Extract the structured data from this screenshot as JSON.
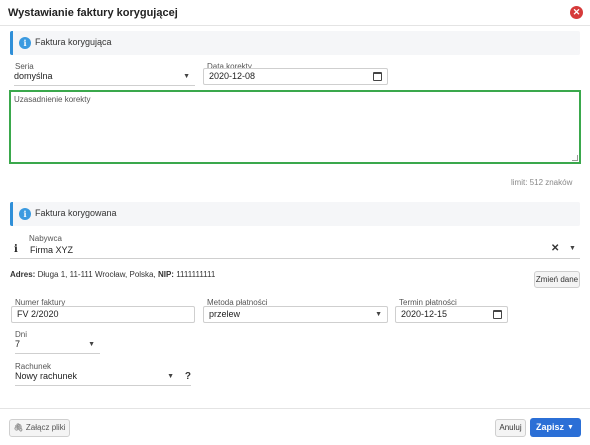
{
  "dialog": {
    "title": "Wystawianie faktury korygującej"
  },
  "section_correction": {
    "title": "Faktura korygująca"
  },
  "seria": {
    "label": "Seria",
    "value": "domyślna"
  },
  "data_korekty": {
    "label": "Data korekty",
    "value": "2020-12-08"
  },
  "uzasadnienie": {
    "placeholder": "Uzasadnienie korekty",
    "limit_text": "limit: 512 znaków"
  },
  "section_corrected": {
    "title": "Faktura korygowana"
  },
  "nabywca": {
    "label": "Nabywca",
    "value": "Firma XYZ"
  },
  "adres": {
    "label": "Adres:",
    "value": "Długa 1, 11-111 Wrocław, Polska,",
    "nip_label": "NIP:",
    "nip_value": "1111111111"
  },
  "zmien_dane_label": "Zmień dane",
  "numer_faktury": {
    "label": "Numer faktury",
    "value": "FV 2/2020"
  },
  "metoda_platnosci": {
    "label": "Metoda płatności",
    "value": "przelew"
  },
  "termin_platnosci": {
    "label": "Termin płatności",
    "value": "2020-12-15"
  },
  "dni": {
    "label": "Dni",
    "value": "7"
  },
  "rachunek": {
    "label": "Rachunek",
    "value": "Nowy rachunek",
    "help": "?"
  },
  "footer": {
    "attach_label": "Załącz pliki",
    "cancel_label": "Anuluj",
    "save_label": "Zapisz"
  },
  "icons": {
    "close": "close-icon",
    "info": "info-icon",
    "calendar": "calendar-icon",
    "paperclip": "paperclip-icon",
    "chevron": "chevron-down-icon"
  },
  "colors": {
    "accent": "#2b6fd6",
    "info": "#3b9ae0",
    "focus_border": "#3aa84c",
    "close": "#d63a3a"
  }
}
